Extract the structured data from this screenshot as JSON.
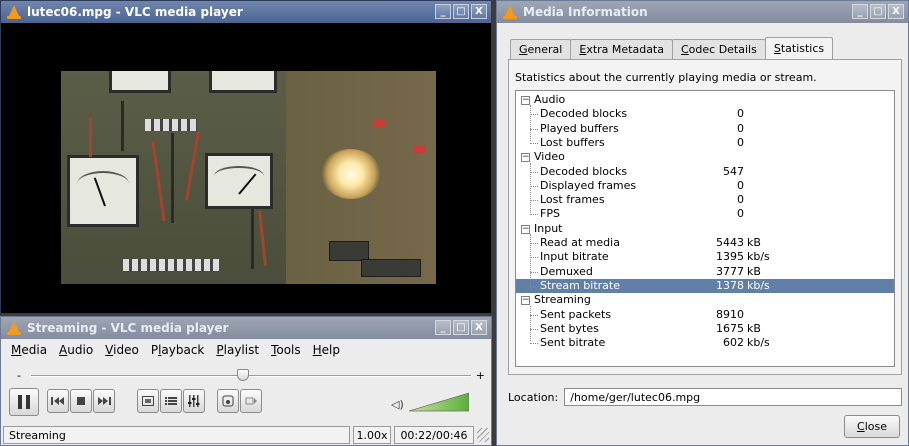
{
  "video_window": {
    "title": "lutec06.mpg - VLC media player",
    "buttons": [
      "_",
      "□",
      "X"
    ]
  },
  "streaming_window": {
    "title": "Streaming - VLC media player",
    "buttons": [
      "_",
      "□",
      "X"
    ],
    "menu": [
      {
        "pre": "",
        "u": "M",
        "post": "edia"
      },
      {
        "pre": "",
        "u": "A",
        "post": "udio"
      },
      {
        "pre": "",
        "u": "V",
        "post": "ideo"
      },
      {
        "pre": "P",
        "u": "l",
        "post": "ayback"
      },
      {
        "pre": "",
        "u": "P",
        "post": "laylist"
      },
      {
        "pre": "",
        "u": "T",
        "post": "ools"
      },
      {
        "pre": "",
        "u": "H",
        "post": "elp"
      }
    ],
    "seek_minus": "-",
    "seek_plus": "+",
    "seek_position": 0.48,
    "volume_level": 1.0,
    "status_text": "Streaming",
    "speed": "1.00x",
    "time": "00:22/00:46"
  },
  "media_info": {
    "title": "Media Information",
    "buttons": [
      "_",
      "□",
      "X"
    ],
    "tabs": [
      {
        "pre": "",
        "u": "G",
        "post": "eneral",
        "selected": false
      },
      {
        "pre": "",
        "u": "E",
        "post": "xtra Metadata",
        "selected": false
      },
      {
        "pre": "",
        "u": "C",
        "post": "odec Details",
        "selected": false
      },
      {
        "pre": "",
        "u": "S",
        "post": "tatistics",
        "selected": true
      }
    ],
    "description": "Statistics about the currently playing media or stream.",
    "groups": [
      {
        "name": "Audio",
        "items": [
          {
            "name": "Decoded blocks",
            "value": "0",
            "unit": ""
          },
          {
            "name": "Played buffers",
            "value": "0",
            "unit": ""
          },
          {
            "name": "Lost buffers",
            "value": "0",
            "unit": ""
          }
        ]
      },
      {
        "name": "Video",
        "items": [
          {
            "name": "Decoded blocks",
            "value": "547",
            "unit": ""
          },
          {
            "name": "Displayed frames",
            "value": "0",
            "unit": ""
          },
          {
            "name": "Lost frames",
            "value": "0",
            "unit": ""
          },
          {
            "name": "FPS",
            "value": "0",
            "unit": ""
          }
        ]
      },
      {
        "name": "Input",
        "items": [
          {
            "name": "Read at media",
            "value": "5443",
            "unit": "kB"
          },
          {
            "name": "Input bitrate",
            "value": "1395",
            "unit": "kb/s"
          },
          {
            "name": "Demuxed",
            "value": "3777",
            "unit": "kB"
          },
          {
            "name": "Stream bitrate",
            "value": "1378",
            "unit": "kb/s",
            "selected": true
          }
        ]
      },
      {
        "name": "Streaming",
        "items": [
          {
            "name": "Sent packets",
            "value": "8910",
            "unit": ""
          },
          {
            "name": "Sent bytes",
            "value": "1675",
            "unit": "kB"
          },
          {
            "name": "Sent bitrate",
            "value": "602",
            "unit": "kb/s"
          }
        ]
      }
    ],
    "location_label": "Location:",
    "location_value": "/home/ger/lutec06.mpg",
    "close_label": {
      "pre": "",
      "u": "C",
      "post": "lose"
    }
  },
  "colors": {
    "title_active": "#4b6493",
    "title_inactive": "#838c9e",
    "selection": "#627fa8",
    "vlc_orange": "#f29a1c"
  }
}
